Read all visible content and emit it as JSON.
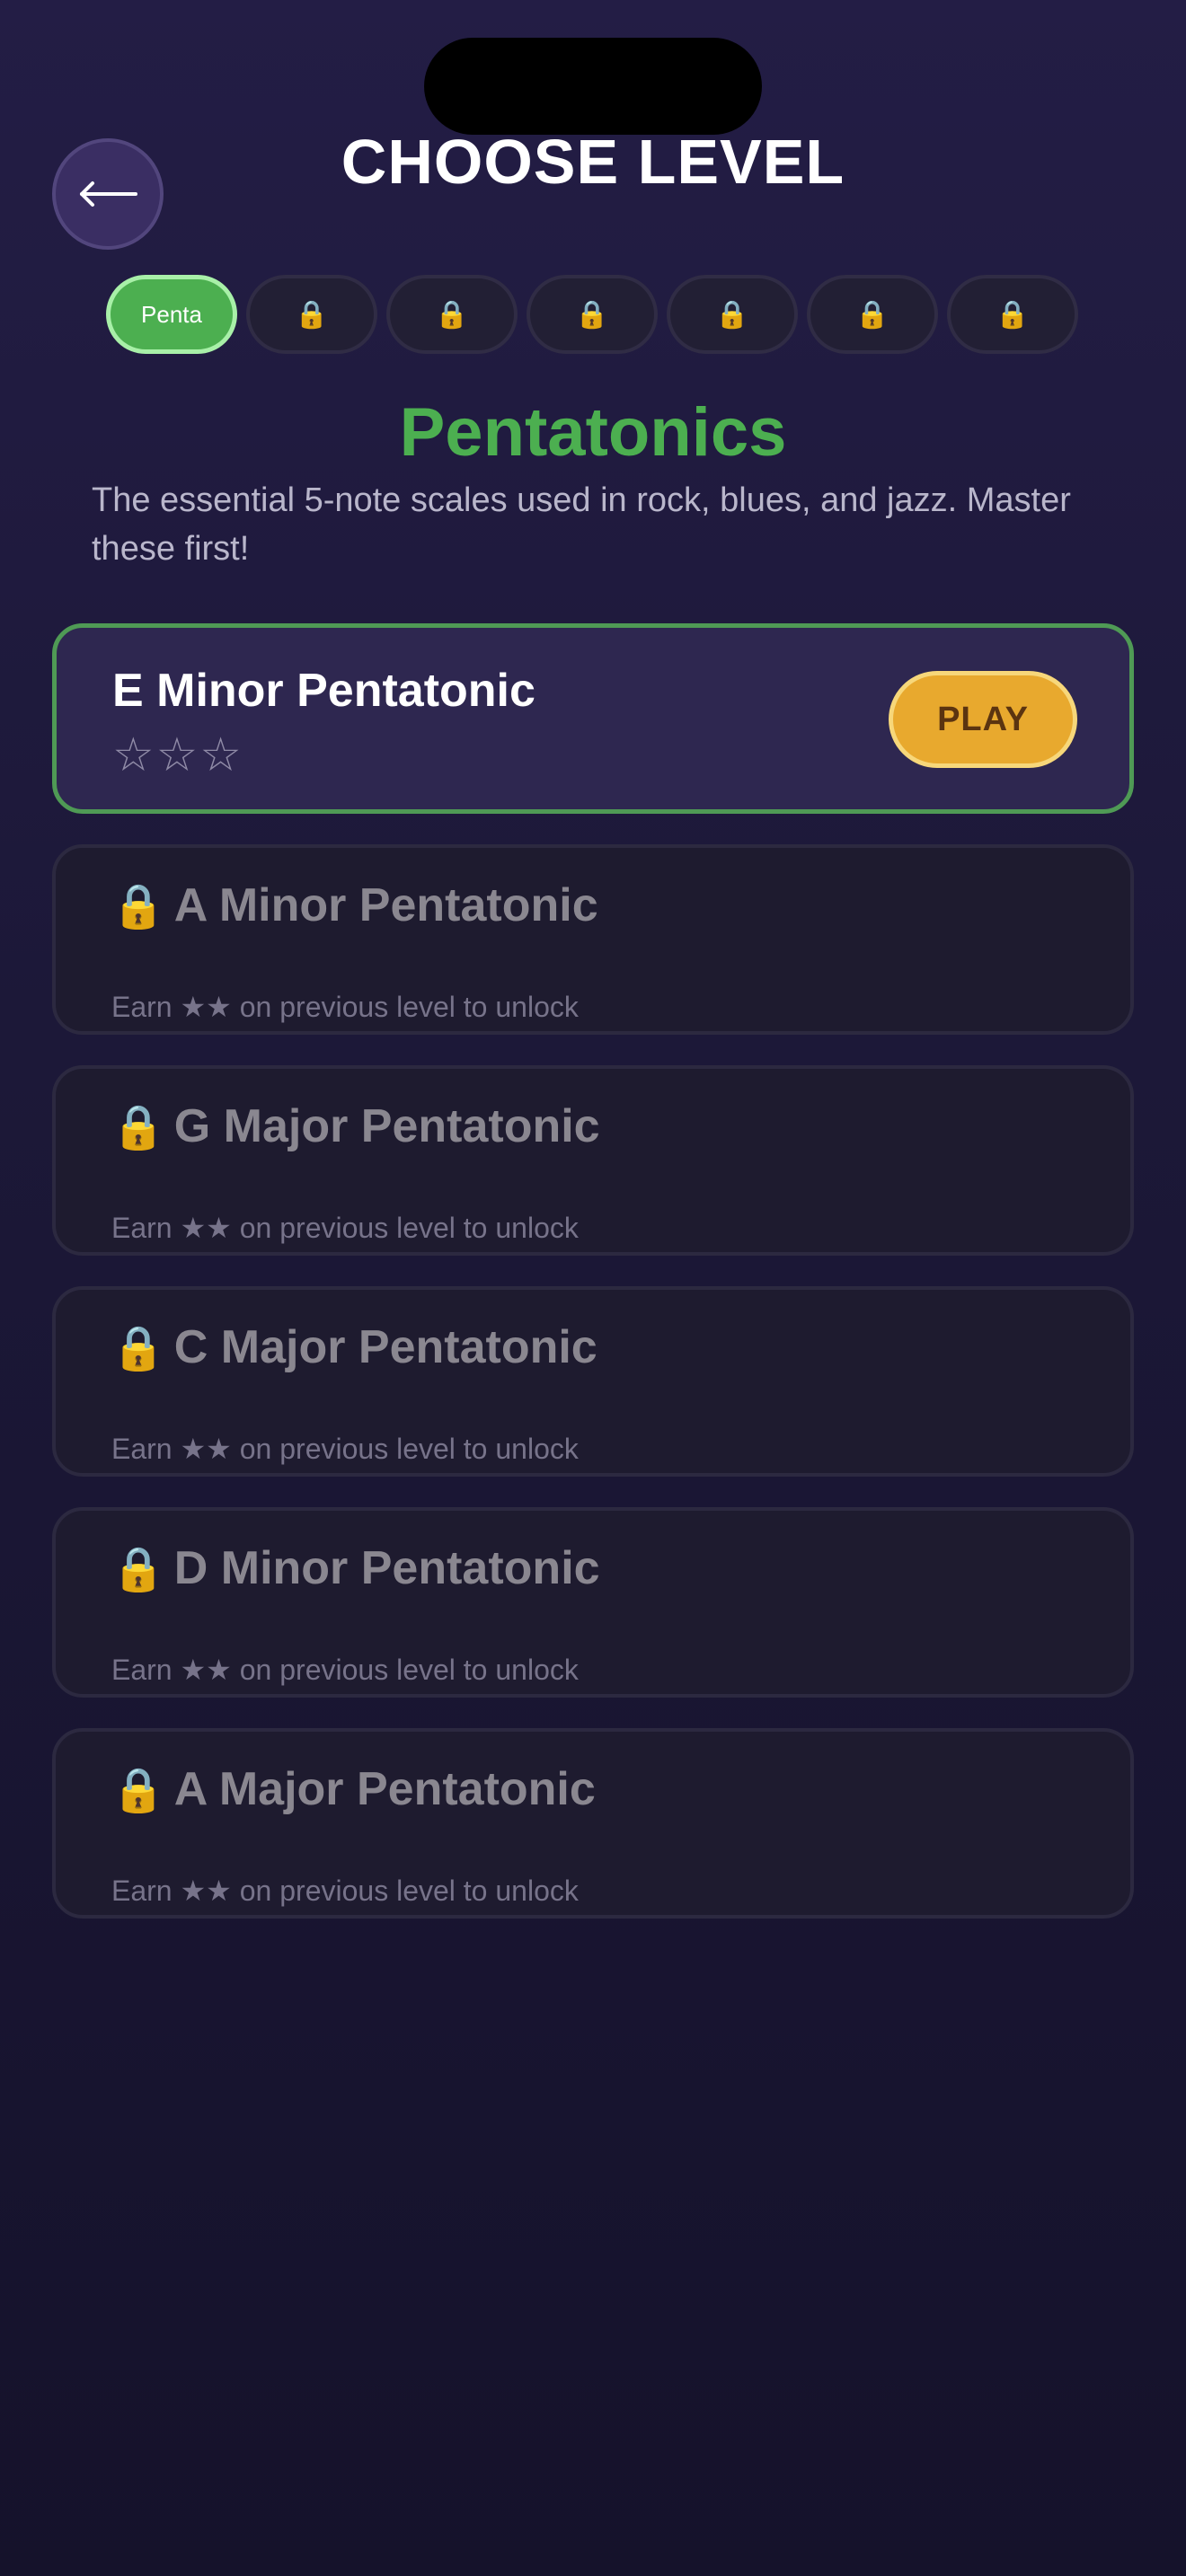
{
  "header": {
    "back_icon": "arrow-left-icon",
    "title": "CHOOSE LEVEL"
  },
  "tabs": [
    {
      "label": "Penta",
      "active": true,
      "locked": false
    },
    {
      "label": "🔒",
      "active": false,
      "locked": true
    },
    {
      "label": "🔒",
      "active": false,
      "locked": true
    },
    {
      "label": "🔒",
      "active": false,
      "locked": true
    },
    {
      "label": "🔒",
      "active": false,
      "locked": true
    },
    {
      "label": "🔒",
      "active": false,
      "locked": true
    },
    {
      "label": "🔒",
      "active": false,
      "locked": true
    }
  ],
  "section": {
    "title": "Pentatonics",
    "description": "The essential 5-note scales used in rock, blues, and jazz. Master these first!"
  },
  "levels": [
    {
      "name": "E Minor Pentatonic",
      "stars": "☆☆☆",
      "play_label": "PLAY",
      "locked": false
    },
    {
      "lock": "🔒",
      "name": "A Minor Pentatonic",
      "hint": "Earn ★★ on previous level to unlock",
      "locked": true
    },
    {
      "lock": "🔒",
      "name": "G Major Pentatonic",
      "hint": "Earn ★★ on previous level to unlock",
      "locked": true
    },
    {
      "lock": "🔒",
      "name": "C Major Pentatonic",
      "hint": "Earn ★★ on previous level to unlock",
      "locked": true
    },
    {
      "lock": "🔒",
      "name": "D Minor Pentatonic",
      "hint": "Earn ★★ on previous level to unlock",
      "locked": true
    },
    {
      "lock": "🔒",
      "name": "A Major Pentatonic",
      "hint": "Earn ★★ on previous level to unlock",
      "locked": true
    }
  ],
  "colors": {
    "accent_green": "#4caf50",
    "play_button": "#e8a92e",
    "background": "#1c1838"
  }
}
